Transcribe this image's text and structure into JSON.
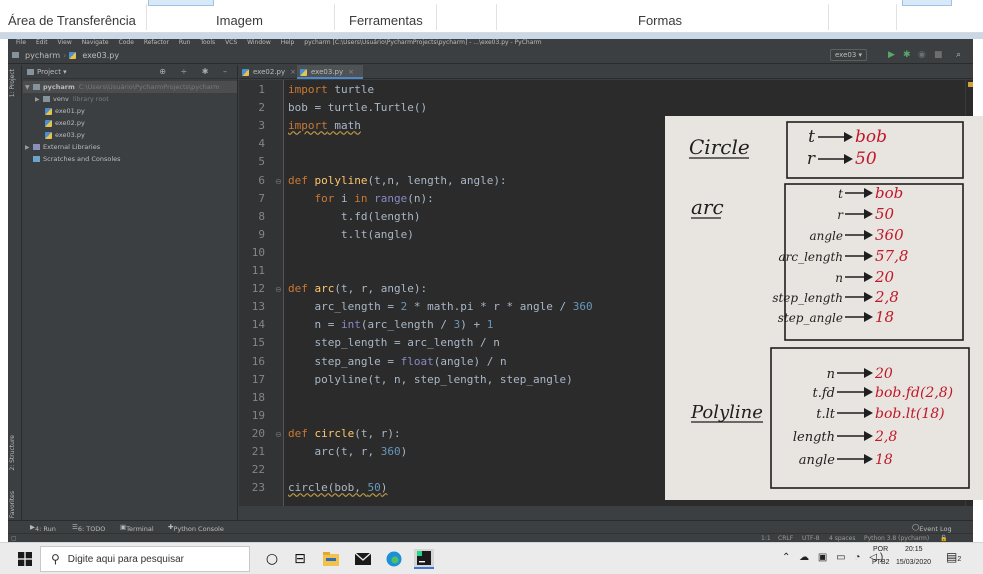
{
  "ribbon": {
    "groups": [
      "Área de Transferência",
      "Imagem",
      "Ferramentas",
      "Formas"
    ]
  },
  "ide": {
    "menu": [
      "File",
      "Edit",
      "View",
      "Navigate",
      "Code",
      "Refactor",
      "Run",
      "Tools",
      "VCS",
      "Window",
      "Help",
      "pycharm [C:\\Users\\Usuário\\PycharmProjects\\pycharm] - ...\\exe03.py - PyCharm"
    ],
    "breadcrumb": {
      "project": "pycharm",
      "file": "exe03.py"
    },
    "run_config": "exe03 ▾",
    "left_tabs": {
      "project": "1: Project",
      "structure": "2: Structure",
      "favorites": "2: Favorites"
    },
    "project_panel": {
      "title": "Project ▾",
      "tree": [
        {
          "label": "pycharm",
          "muted": "C:\\Users\\Usuário\\PycharmProjects\\pycharm"
        },
        {
          "label": "venv",
          "muted": "library root"
        },
        {
          "label": "exe01.py"
        },
        {
          "label": "exe02.py"
        },
        {
          "label": "exe03.py"
        },
        {
          "label": "External Libraries"
        },
        {
          "label": "Scratches and Consoles"
        }
      ]
    },
    "tabs": [
      {
        "label": "exe02.py",
        "close": "×"
      },
      {
        "label": "exe03.py",
        "close": "×"
      }
    ],
    "line_numbers": [
      "1",
      "2",
      "3",
      "4",
      "5",
      "6",
      "7",
      "8",
      "9",
      "10",
      "11",
      "12",
      "13",
      "14",
      "15",
      "16",
      "17",
      "18",
      "19",
      "20",
      "21",
      "22",
      "23"
    ],
    "code_lines": [
      "import turtle",
      "bob = turtle.Turtle()",
      "import math",
      "",
      "",
      "def polyline(t,n, length, angle):",
      "    for i in range(n):",
      "        t.fd(length)",
      "        t.lt(angle)",
      "",
      "",
      "def arc(t, r, angle):",
      "    arc_length = 2 * math.pi * r * angle / 360",
      "    n = int(arc_length / 3) + 1",
      "    step_length = arc_length / n",
      "    step_angle = float(angle) / n",
      "    polyline(t, n, step_length, step_angle)",
      "",
      "",
      "def circle(t, r):",
      "    arc(t, r, 360)",
      "",
      "circle(bob, 50)"
    ],
    "bottom_tabs": [
      "4: Run",
      "6: TODO",
      "Terminal",
      "Python Console"
    ],
    "event_log": "Event Log",
    "status": {
      "position": "1:1",
      "line_sep": "CRLF",
      "encoding": "UTF-8",
      "indent": "4 spaces",
      "interpreter": "Python 3.8 (pycharm)"
    }
  },
  "photo": {
    "sections": [
      {
        "title": "Circle",
        "rows": [
          {
            "param": "t",
            "value": "bob"
          },
          {
            "param": "r",
            "value": "50"
          }
        ]
      },
      {
        "title": "arc",
        "rows": [
          {
            "param": "t",
            "value": "bob"
          },
          {
            "param": "r",
            "value": "50"
          },
          {
            "param": "angle",
            "value": "360"
          },
          {
            "param": "arc_length",
            "value": "57,8"
          },
          {
            "param": "n",
            "value": "20"
          },
          {
            "param": "step_length",
            "value": "2,8"
          },
          {
            "param": "step_angle",
            "value": "18"
          }
        ]
      },
      {
        "title": "Polyline",
        "rows": [
          {
            "param": "n",
            "value": "20"
          },
          {
            "param": "t.fd",
            "value": "bob.fd(2,8)"
          },
          {
            "param": "t.lt",
            "value": "bob.lt(18)"
          },
          {
            "param": "length",
            "value": "2,8"
          },
          {
            "param": "angle",
            "value": "18"
          }
        ]
      }
    ],
    "ink_param": "#1f1f1f",
    "ink_value": "#c0182a"
  },
  "taskbar": {
    "search_placeholder": "Digite aqui para pesquisar",
    "language": "POR",
    "keyboard": "PTB2",
    "time": "20:15",
    "date": "15/03/2020",
    "notifications": "2"
  }
}
